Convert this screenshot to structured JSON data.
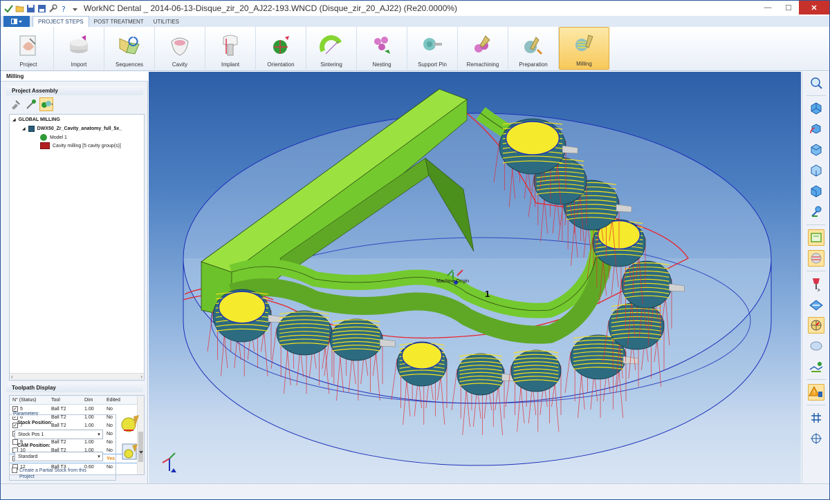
{
  "window": {
    "title": "WorkNC Dental _ 2014-06-13-Disque_zir_20_AJ22-193.WNCD (Disque_zir_20_AJ22) (Re20.0000%)",
    "minimize": "—",
    "maximize": "☐",
    "close": "✕"
  },
  "ribbon": {
    "tabs": [
      "PROJECT STEPS",
      "POST TREATMENT",
      "UTILITIES"
    ],
    "buttons": [
      {
        "label": "Project",
        "icon": "project-icon"
      },
      {
        "label": "Import",
        "icon": "import-icon"
      },
      {
        "label": "Sequences",
        "icon": "sequences-icon"
      },
      {
        "label": "Cavity",
        "icon": "cavity-icon"
      },
      {
        "label": "Implant",
        "icon": "implant-icon"
      },
      {
        "label": "Orientation",
        "icon": "orientation-icon"
      },
      {
        "label": "Sintering",
        "icon": "sintering-icon"
      },
      {
        "label": "Nesting",
        "icon": "nesting-icon"
      },
      {
        "label": "Support Pin",
        "icon": "support-pin-icon"
      },
      {
        "label": "Remachining",
        "icon": "remachining-icon"
      },
      {
        "label": "Preparation",
        "icon": "preparation-icon"
      },
      {
        "label": "Milling",
        "icon": "milling-icon"
      }
    ]
  },
  "left_panel": {
    "title": "Milling",
    "assembly_title": "Project Assembly",
    "tree": {
      "global": "GLOBAL MILLING",
      "project": "DWX50_Zr_Cavity_anatomy_full_5x_",
      "model": "Model 1",
      "cavity": "Cavity milling [5 cavity group(s)]"
    },
    "toolpath_title": "Toolpath Display",
    "columns": [
      "N° (Status)",
      "Tool",
      "Dim",
      "Edited"
    ],
    "rows": [
      {
        "n": "5",
        "tool": "Ball T2",
        "dim": "1.00",
        "edited": "No",
        "checked": true,
        "selected": false
      },
      {
        "n": "6",
        "tool": "Ball T2",
        "dim": "1.00",
        "edited": "No",
        "checked": true,
        "selected": false
      },
      {
        "n": "7",
        "tool": "Ball T2",
        "dim": "1.00",
        "edited": "No",
        "checked": true,
        "selected": false
      },
      {
        "n": "8",
        "tool": "Ball T2",
        "dim": "1.00",
        "edited": "No",
        "checked": true,
        "selected": false
      },
      {
        "n": "9",
        "tool": "Ball T2",
        "dim": "1.00",
        "edited": "No",
        "checked": false,
        "selected": false
      },
      {
        "n": "10",
        "tool": "Ball T2",
        "dim": "1.00",
        "edited": "No",
        "checked": false,
        "selected": false
      },
      {
        "n": "11",
        "tool": "Ball T2",
        "dim": "1.00",
        "edited": "Yes",
        "checked": true,
        "selected": true
      },
      {
        "n": "12",
        "tool": "Ball T3",
        "dim": "0.60",
        "edited": "No",
        "checked": false,
        "selected": false
      }
    ],
    "params": {
      "legend": "Parameters",
      "stock_label": "Stock Position:",
      "stock_value": "Stock Pos 1",
      "cam_label": "CAM Position:",
      "cam_value": "Standard",
      "partial_stock": "Create a Partial Stock from this Project"
    }
  },
  "viewport": {
    "origin_label": "Machine Origin",
    "model_number": "1",
    "colors": {
      "body": "#86d531",
      "crowns": "#2d6b80",
      "toolpath": "#f7e316",
      "travel": "#e8242c",
      "disk": "#1b2fb8"
    }
  }
}
